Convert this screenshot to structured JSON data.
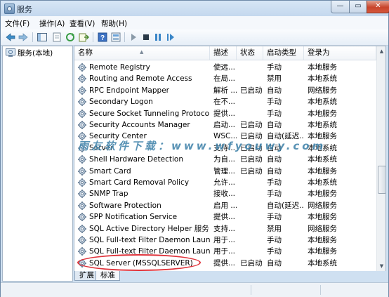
{
  "window": {
    "title": "服务"
  },
  "menu": [
    "文件(F)",
    "操作(A)",
    "查看(V)",
    "帮助(H)"
  ],
  "left_tree": {
    "label": "服务(本地)"
  },
  "columns": {
    "name": "名称",
    "desc": "描述",
    "status": "状态",
    "startup": "启动类型",
    "logon": "登录为"
  },
  "services": [
    {
      "name": "Remote Registry",
      "desc": "使远...",
      "status": "",
      "startup": "手动",
      "logon": "本地服务"
    },
    {
      "name": "Routing and Remote Access",
      "desc": "在局...",
      "status": "",
      "startup": "禁用",
      "logon": "本地系统"
    },
    {
      "name": "RPC Endpoint Mapper",
      "desc": "解析 ...",
      "status": "已启动",
      "startup": "自动",
      "logon": "网络服务"
    },
    {
      "name": "Secondary Logon",
      "desc": "在不...",
      "status": "",
      "startup": "手动",
      "logon": "本地系统"
    },
    {
      "name": "Secure Socket Tunneling Protocol S...",
      "desc": "提供...",
      "status": "",
      "startup": "手动",
      "logon": "本地服务"
    },
    {
      "name": "Security Accounts Manager",
      "desc": "启动...",
      "status": "已启动",
      "startup": "自动",
      "logon": "本地系统"
    },
    {
      "name": "Security Center",
      "desc": "WSC...",
      "status": "已启动",
      "startup": "自动(延迟...",
      "logon": "本地服务"
    },
    {
      "name": "Server",
      "desc": "支持...",
      "status": "已启动",
      "startup": "自动",
      "logon": "本地系统"
    },
    {
      "name": "Shell Hardware Detection",
      "desc": "为自...",
      "status": "已启动",
      "startup": "自动",
      "logon": "本地系统"
    },
    {
      "name": "Smart Card",
      "desc": "管理...",
      "status": "已启动",
      "startup": "自动",
      "logon": "本地服务"
    },
    {
      "name": "Smart Card Removal Policy",
      "desc": "允许...",
      "status": "",
      "startup": "手动",
      "logon": "本地系统"
    },
    {
      "name": "SNMP Trap",
      "desc": "接收...",
      "status": "",
      "startup": "手动",
      "logon": "本地服务"
    },
    {
      "name": "Software Protection",
      "desc": "启用 ...",
      "status": "",
      "startup": "自动(延迟...",
      "logon": "网络服务"
    },
    {
      "name": "SPP Notification Service",
      "desc": "提供...",
      "status": "",
      "startup": "手动",
      "logon": "本地服务"
    },
    {
      "name": "SQL Active Directory Helper 服务",
      "desc": "支持...",
      "status": "",
      "startup": "禁用",
      "logon": "网络服务"
    },
    {
      "name": "SQL Full-text Filter Daemon Launche...",
      "desc": "用于...",
      "status": "",
      "startup": "手动",
      "logon": "本地服务"
    },
    {
      "name": "SQL Full-text Filter Daemon Launche...",
      "desc": "用于...",
      "status": "",
      "startup": "手动",
      "logon": "本地服务"
    },
    {
      "name": "SQL Server (MSSQLSERVER)",
      "desc": "提供...",
      "status": "已启动",
      "startup": "自动",
      "logon": "本地系统"
    }
  ],
  "tabs": [
    "扩展",
    "标准"
  ],
  "watermark": "雨友软件下载：www.wfyouwy.com",
  "colors": {
    "highlight": "#e0333b",
    "title_bg": "#cfe0f1"
  }
}
